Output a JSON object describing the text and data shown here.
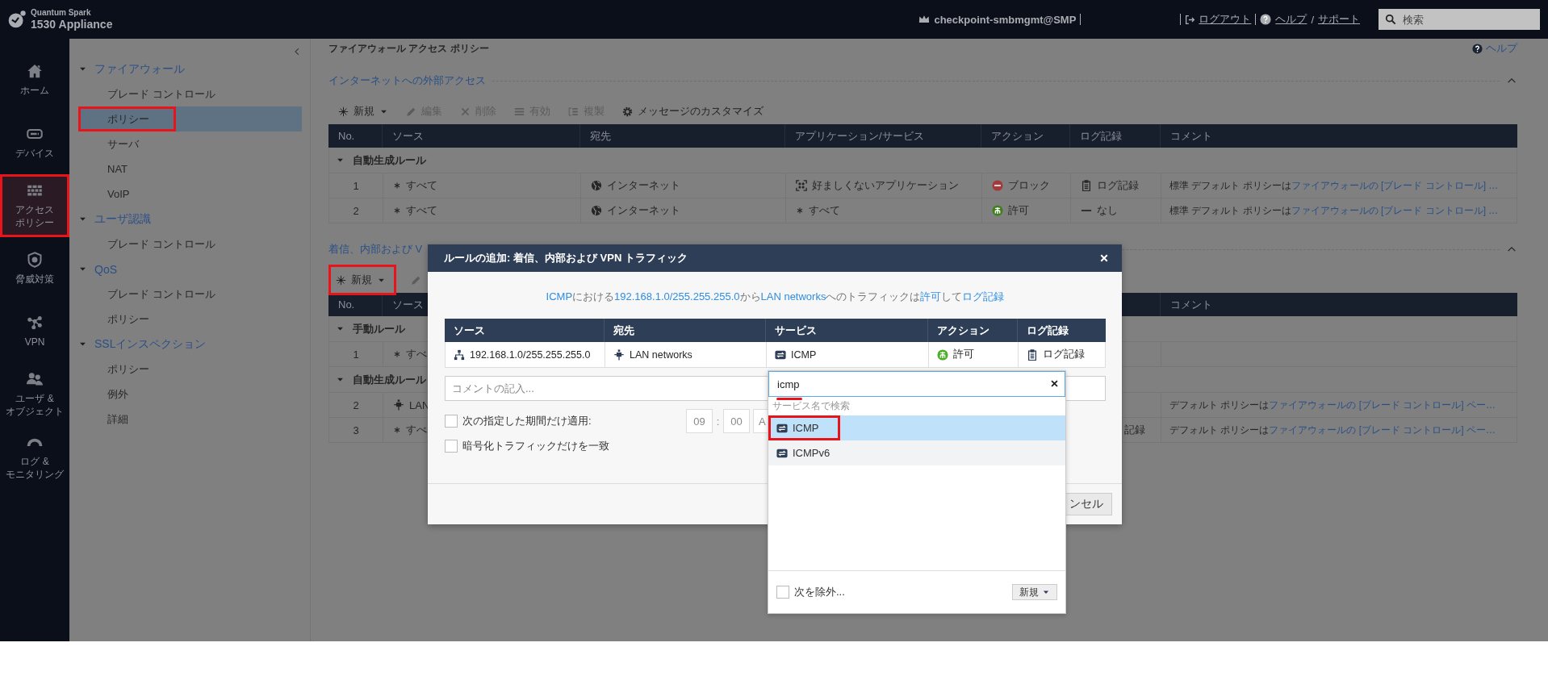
{
  "topbar": {
    "product": "Quantum Spark",
    "model": "1530 Appliance",
    "user": "checkpoint-smbmgmt@SMP",
    "logout": "ログアウト",
    "help": "ヘルプ",
    "help_separator": "/",
    "support": "サポート",
    "search": {
      "placeholder": "検索"
    }
  },
  "rail": [
    {
      "kind": "home",
      "label": [
        "ホーム"
      ],
      "selected": false,
      "highlighted": false
    },
    {
      "kind": "device",
      "label": [
        "デバイス"
      ],
      "selected": false,
      "highlighted": false
    },
    {
      "kind": "wall",
      "label": [
        "アクセス",
        "ポリシー"
      ],
      "selected": true,
      "highlighted": true
    },
    {
      "kind": "shield",
      "label": [
        "脅威対策"
      ],
      "selected": false,
      "highlighted": false
    },
    {
      "kind": "vpn",
      "label": [
        "VPN"
      ],
      "selected": false,
      "highlighted": false
    },
    {
      "kind": "users",
      "label": [
        "ユーザ &",
        "オブジェクト"
      ],
      "selected": false,
      "highlighted": false
    },
    {
      "kind": "gauge",
      "label": [
        "ログ &",
        "モニタリング"
      ],
      "selected": false,
      "highlighted": false
    }
  ],
  "nav": [
    {
      "label": "ファイアウォール",
      "expanded": true,
      "children": [
        {
          "label": "ブレード コントロール",
          "selected": false,
          "highlighted": false
        },
        {
          "label": "ポリシー",
          "selected": true,
          "highlighted": true
        },
        {
          "label": "サーバ",
          "selected": false,
          "highlighted": false
        },
        {
          "label": "NAT",
          "selected": false,
          "highlighted": false
        },
        {
          "label": "VoIP",
          "selected": false,
          "highlighted": false
        }
      ]
    },
    {
      "label": "ユーザ認識",
      "expanded": true,
      "children": [
        {
          "label": "ブレード コントロール",
          "selected": false,
          "highlighted": false
        }
      ]
    },
    {
      "label": "QoS",
      "expanded": true,
      "children": [
        {
          "label": "ブレード コントロール",
          "selected": false,
          "highlighted": false
        },
        {
          "label": "ポリシー",
          "selected": false,
          "highlighted": false
        }
      ]
    },
    {
      "label": "SSLインスペクション",
      "expanded": true,
      "children": [
        {
          "label": "ポリシー",
          "selected": false,
          "highlighted": false
        },
        {
          "label": "例外",
          "selected": false,
          "highlighted": false
        },
        {
          "label": "詳細",
          "selected": false,
          "highlighted": false
        }
      ]
    }
  ],
  "page": {
    "title": "ファイアウォール アクセス ポリシー",
    "help": "ヘルプ"
  },
  "sections": [
    {
      "title": "インターネットへの外部アクセス",
      "expanded": true,
      "toolbar": [
        {
          "kind": "new",
          "label": "新規",
          "disabled": false,
          "highlighted": false
        },
        {
          "kind": "edit",
          "label": "編集",
          "disabled": true,
          "highlighted": false
        },
        {
          "kind": "delete",
          "label": "削除",
          "disabled": true,
          "highlighted": false
        },
        {
          "kind": "enable",
          "label": "有効",
          "disabled": true,
          "highlighted": false
        },
        {
          "kind": "clone",
          "label": "複製",
          "disabled": true,
          "highlighted": false
        },
        {
          "kind": "gear",
          "label": "メッセージのカスタマイズ",
          "disabled": false,
          "highlighted": false
        }
      ],
      "columns": [
        {
          "kind": "number",
          "label": "No."
        },
        {
          "kind": "source",
          "label": "ソース"
        },
        {
          "kind": "destination",
          "label": "宛先"
        },
        {
          "kind": "service",
          "label": "アプリケーション/サービス"
        },
        {
          "kind": "action",
          "label": "アクション"
        },
        {
          "kind": "log",
          "label": "ログ記録"
        },
        {
          "kind": "comment",
          "label": "コメント"
        }
      ],
      "groups": [
        {
          "label": "自動生成ルール",
          "expanded": true,
          "rows": [
            {
              "no": "1",
              "source": {
                "kind": "any",
                "text": "すべて"
              },
              "destination": {
                "kind": "globe",
                "text": "インターネット"
              },
              "service": {
                "kind": "apps",
                "text": "好ましくないアプリケーション"
              },
              "action": {
                "kind": "block",
                "text": "ブロック"
              },
              "log": {
                "kind": "log",
                "text": "ログ記録"
              },
              "comment": {
                "text": "標準 デフォルト ポリシーは",
                "link": "ファイアウォールの [ブレード コントロール] …"
              }
            },
            {
              "no": "2",
              "source": {
                "kind": "any",
                "text": "すべて"
              },
              "destination": {
                "kind": "globe",
                "text": "インターネット"
              },
              "service": {
                "kind": "any",
                "text": "すべて"
              },
              "action": {
                "kind": "accept",
                "text": "許可"
              },
              "log": {
                "kind": "none",
                "text": "なし"
              },
              "comment": {
                "text": "標準 デフォルト ポリシーは",
                "link": "ファイアウォールの [ブレード コントロール] …"
              }
            }
          ]
        }
      ]
    },
    {
      "title": "着信、内部および V",
      "expanded": true,
      "toolbar": [
        {
          "kind": "new",
          "label": "新規",
          "disabled": false,
          "highlighted": true
        },
        {
          "kind": "edit",
          "disabled": true,
          "highlighted": false
        }
      ],
      "columns": [
        {
          "kind": "number",
          "label": "No."
        },
        {
          "kind": "source",
          "label": "ソース"
        },
        {
          "kind": "comment",
          "label": "コメント"
        }
      ],
      "groups": [
        {
          "label": "手動ルール",
          "expanded": true,
          "rows": [
            {
              "no": "1",
              "source": {
                "kind": "any",
                "text": "すべ"
              }
            }
          ]
        },
        {
          "label": "自動生成ルール",
          "expanded": true,
          "rows": [
            {
              "no": "2",
              "source": {
                "kind": "lan",
                "text": "LAN"
              },
              "comment": {
                "text": "デフォルト ポリシーは",
                "link": "ファイアウォールの [ブレード コントロール] ペー…"
              }
            },
            {
              "no": "3",
              "source": {
                "kind": "any",
                "text": "すべ"
              },
              "log": {
                "text": "記録"
              },
              "comment": {
                "text": "デフォルト ポリシーは",
                "link": "ファイアウォールの [ブレード コントロール] ペー…"
              }
            }
          ]
        }
      ]
    }
  ],
  "modal": {
    "title": "ルールの追加: 着信、内部および VPN トラフィック",
    "summary": [
      {
        "text": "ICMP",
        "link": true
      },
      {
        "text": "における",
        "link": false
      },
      {
        "text": "192.168.1.0/255.255.255.0",
        "link": true
      },
      {
        "text": "から",
        "link": false
      },
      {
        "text": "LAN networks",
        "link": true
      },
      {
        "text": "へのトラフィックは",
        "link": false
      },
      {
        "text": "許可",
        "link": true
      },
      {
        "text": "して",
        "link": false
      },
      {
        "text": "ログ記録",
        "link": true
      }
    ],
    "columns": [
      "ソース",
      "宛先",
      "サービス",
      "アクション",
      "ログ記録"
    ],
    "row": [
      {
        "kind": "network",
        "text": "192.168.1.0/255.255.255.0"
      },
      {
        "kind": "lan",
        "text": "LAN networks"
      },
      {
        "kind": "service",
        "text": "ICMP"
      },
      {
        "kind": "accept",
        "text": "許可"
      },
      {
        "kind": "log",
        "text": "ログ記録"
      }
    ],
    "comment": {
      "placeholder": "コメントの記入..."
    },
    "options": [
      {
        "kind": "schedule",
        "label": "次の指定した期間だけ適用:",
        "checked": false
      },
      {
        "kind": "plain",
        "label": "暗号化トラフィックだけを一致",
        "checked": false
      }
    ],
    "time": {
      "hour": "09",
      "separator": ":",
      "minute": "00",
      "period": "A"
    },
    "cancel": "ンセル"
  },
  "dropdown": {
    "value": "icmp",
    "underlined": true,
    "hint": "サービス名で検索",
    "options": [
      {
        "label": "ICMP",
        "selected": true,
        "hovered": false,
        "highlighted": true
      },
      {
        "label": "ICMPv6",
        "selected": false,
        "hovered": true,
        "highlighted": false
      }
    ],
    "exclude": {
      "label": "次を除外...",
      "checked": false
    },
    "new_button": "新規"
  }
}
